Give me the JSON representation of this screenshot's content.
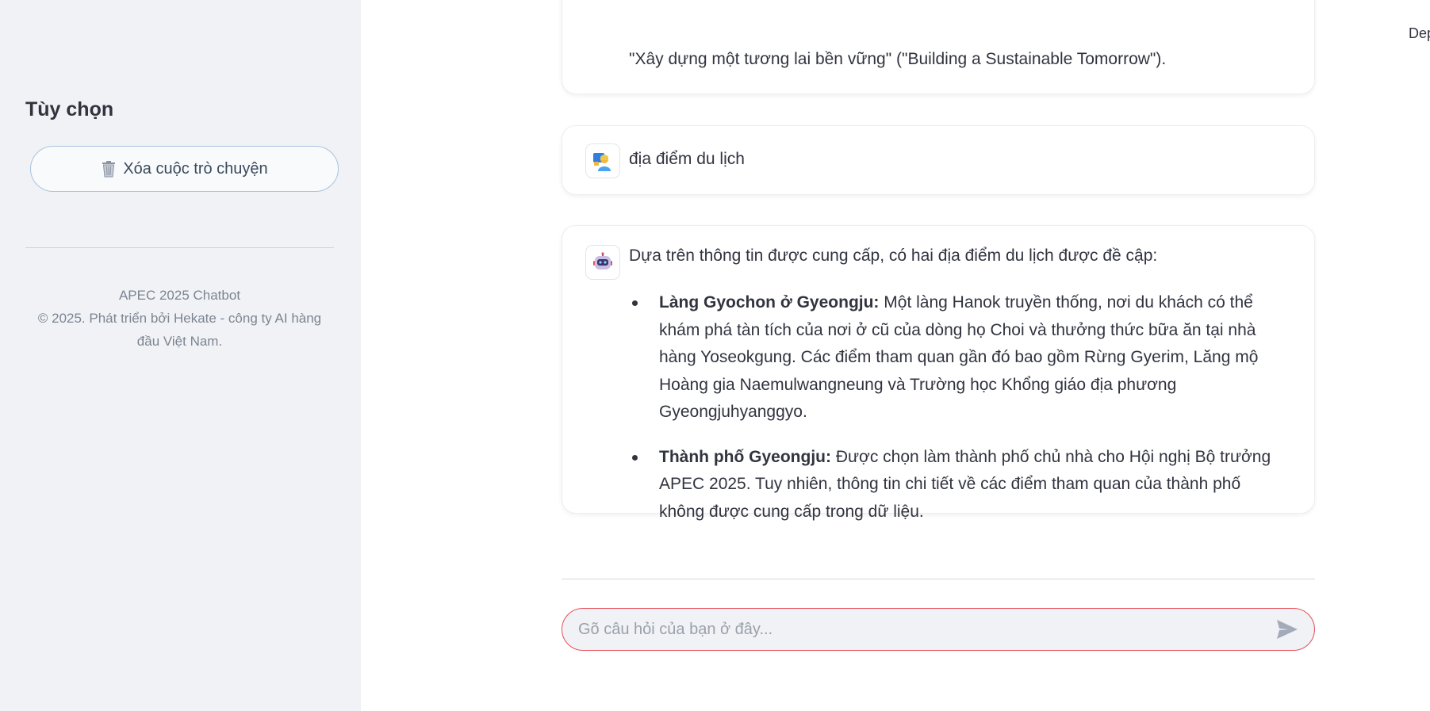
{
  "sidebar": {
    "title": "Tùy chọn",
    "clear_button_label": "Xóa cuộc trò chuyện",
    "footer_line1": "APEC 2025 Chatbot",
    "footer_line2": "© 2025. Phát triển bởi Hekate - công ty AI hàng đầu Việt Nam."
  },
  "header": {
    "deploy_label": "Dep"
  },
  "messages": {
    "previous_tail": "\"Xây dựng một tương lai bền vững\" (\"Building a Sustainable Tomorrow\").",
    "user_text": "địa điểm du lịch",
    "bot_intro": "Dựa trên thông tin được cung cấp, có hai địa điểm du lịch được đề cập:",
    "bot_items": [
      {
        "title": "Làng Gyochon ở Gyeongju:",
        "body": " Một làng Hanok truyền thống, nơi du khách có thể khám phá tàn tích của nơi ở cũ của dòng họ Choi và thưởng thức bữa ăn tại nhà hàng Yoseokgung. Các điểm tham quan gần đó bao gồm Rừng Gyerim, Lăng mộ Hoàng gia Naemulwangneung và Trường học Khổng giáo địa phương Gyeongjuhyanggyo."
      },
      {
        "title": "Thành phố Gyeongju:",
        "body": " Được chọn làm thành phố chủ nhà cho Hội nghị Bộ trưởng APEC 2025. Tuy nhiên, thông tin chi tiết về các điểm tham quan của thành phố không được cung cấp trong dữ liệu."
      }
    ]
  },
  "chat_input": {
    "placeholder": "Gõ câu hỏi của bạn ở đây...",
    "value": ""
  },
  "icons": {
    "clear": "trash-icon",
    "user_avatar": "user-avatar-icon",
    "bot_avatar": "robot-avatar-icon",
    "send": "send-icon"
  },
  "colors": {
    "sidebar_bg": "#f0f2f6",
    "input_border": "#e8505b",
    "button_border": "#a8c3e0"
  }
}
